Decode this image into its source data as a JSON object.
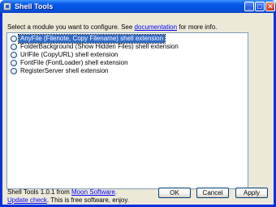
{
  "window": {
    "title": "Shell Tools"
  },
  "titlebar_buttons": {
    "minimize": "_",
    "maximize": "□",
    "close": "✕"
  },
  "instructions": {
    "before": "Select a module you want to configure. See ",
    "link": "documentation",
    "after": " for more info."
  },
  "modules": [
    {
      "label": "AnyFile (Filenote, Copy Filename) shell extension",
      "selected": true
    },
    {
      "label": "FolderBackground (Show Hidden Files) shell extension",
      "selected": false
    },
    {
      "label": "UrlFile (CopyURL) shell extension",
      "selected": false
    },
    {
      "label": "FontFile (FontLoader) shell extension",
      "selected": false
    },
    {
      "label": "RegisterServer shell extension",
      "selected": false
    }
  ],
  "footer": {
    "line1_before": "Shell Tools 1.0.1 from ",
    "line1_link": "Moon Software",
    "line1_after": ".",
    "line2_link": "Update check",
    "line2_after": ". This is free software, enjoy."
  },
  "buttons": {
    "ok": "OK",
    "cancel": "Cancel",
    "apply": "Apply"
  },
  "icons": {
    "app": "app-window-icon",
    "module": "radio-bullet-icon"
  }
}
